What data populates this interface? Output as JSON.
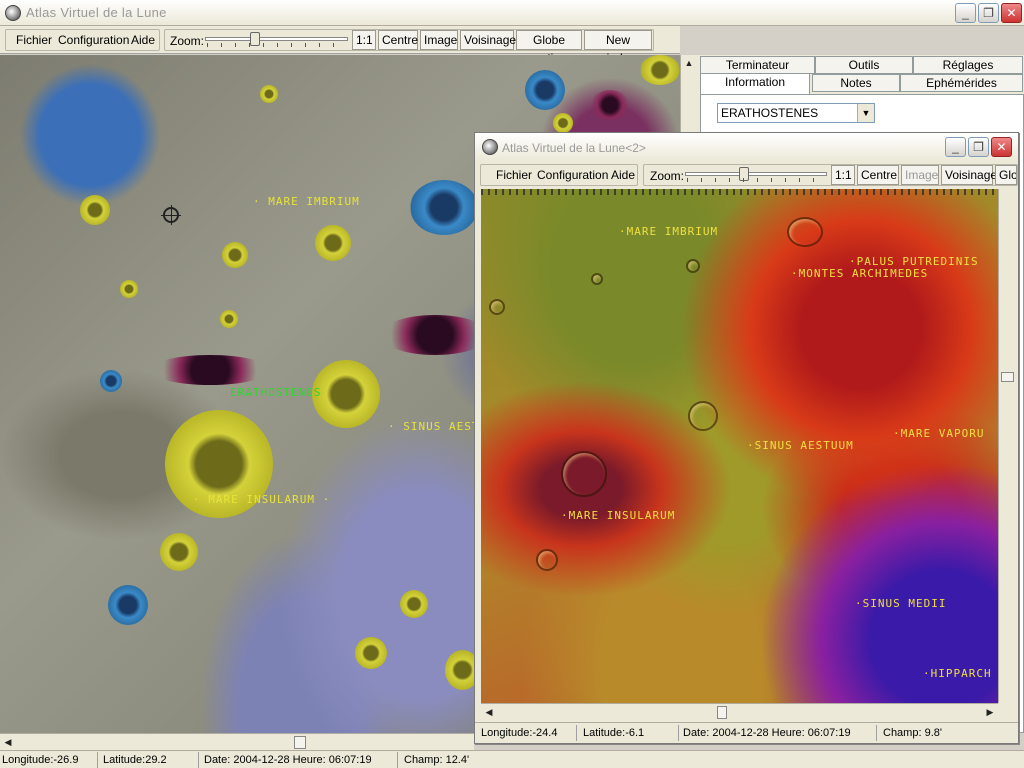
{
  "main_window": {
    "title": "Atlas Virtuel de la Lune",
    "menu": {
      "file": "Fichier",
      "config": "Configuration",
      "help": "Aide"
    },
    "toolbar": {
      "zoom_label": "Zoom:",
      "btn_1to1": "1:1",
      "btn_center": "Centre",
      "btn_image": "Image",
      "btn_neighborhood": "Voisinage",
      "btn_globe": "Globe entier",
      "btn_new_window": "New window"
    },
    "map_labels": {
      "mare_imbrium": "· MARE IMBRIUM",
      "erathostenes": "ERATHOSTENES",
      "sinus_aestuum": "· SINUS AESTU",
      "mare_insularum": "· MARE INSULARUM ·"
    },
    "status": {
      "longitude": "Longitude:-26.9",
      "latitude": "Latitude:29.2",
      "datetime": "Date: 2004-12-28  Heure: 06:07:19",
      "field": "Champ: 12.4'"
    }
  },
  "right_panel": {
    "tabs_row1": [
      "Terminateur",
      "Outils",
      "Réglages"
    ],
    "tabs_row2": [
      "Information",
      "Notes",
      "Ephémérides"
    ],
    "active_tab": "Information",
    "selected_feature": "ERATHOSTENES"
  },
  "second_window": {
    "title": "Atlas Virtuel de la Lune<2>",
    "menu": {
      "file": "Fichier",
      "config": "Configuration",
      "help": "Aide"
    },
    "toolbar": {
      "zoom_label": "Zoom:",
      "btn_1to1": "1:1",
      "btn_center": "Centre",
      "btn_image": "Image",
      "btn_neighborhood": "Voisinage",
      "btn_globe_partial": "Glo"
    },
    "map_labels": {
      "mare_imbrium": "·MARE IMBRIUM",
      "palus_putredinis": "·PALUS PUTREDINIS",
      "montes_archimedes": "·MONTES ARCHIMEDES",
      "sinus_aestuum": "·SINUS AESTUUM",
      "mare_vaporum": "·MARE VAPORU",
      "mare_insularum": "·MARE INSULARUM",
      "sinus_medii": "·SINUS MEDII",
      "hipparchus": "·HIPPARCH"
    },
    "status": {
      "longitude": "Longitude:-24.4",
      "latitude": "Latitude:-6.1",
      "datetime": "Date: 2004-12-28  Heure: 06:07:19",
      "field": "Champ: 9.8'"
    }
  },
  "colors": {
    "label_yellow": "#e8e23a",
    "label_green": "#2cd72c",
    "window_bg": "#ece9d8"
  },
  "icons": [
    "moon-app-icon",
    "minimize-icon",
    "maximize-icon",
    "close-icon",
    "crosshair-cursor-icon",
    "dropdown-arrow-icon",
    "scroll-arrow-icon"
  ]
}
